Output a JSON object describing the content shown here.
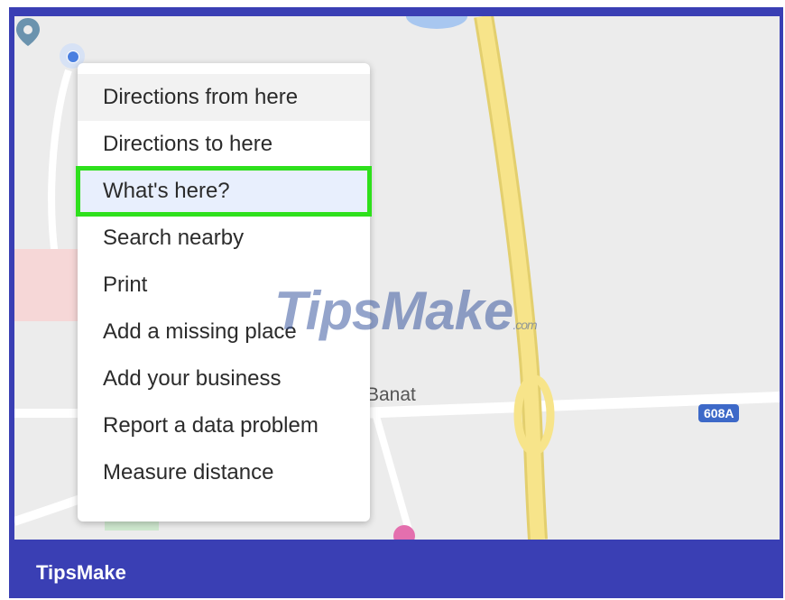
{
  "context_menu": {
    "items": [
      {
        "label": "Directions from here"
      },
      {
        "label": "Directions to here"
      },
      {
        "label": "What's here?"
      },
      {
        "label": "Search nearby"
      },
      {
        "label": "Print"
      },
      {
        "label": "Add a missing place"
      },
      {
        "label": "Add your business"
      },
      {
        "label": "Report a data problem"
      },
      {
        "label": "Measure distance"
      }
    ],
    "highlighted_item": "What's here?"
  },
  "map": {
    "place_label": "Banat",
    "road_shield": "608A"
  },
  "watermark": {
    "text": "TipsMake",
    "suffix": ".com"
  },
  "footer": {
    "brand": "TipsMake"
  },
  "colors": {
    "frame": "#3a3fb4",
    "highlight_outline": "#2ee01c",
    "highway": "#f5e27a"
  }
}
